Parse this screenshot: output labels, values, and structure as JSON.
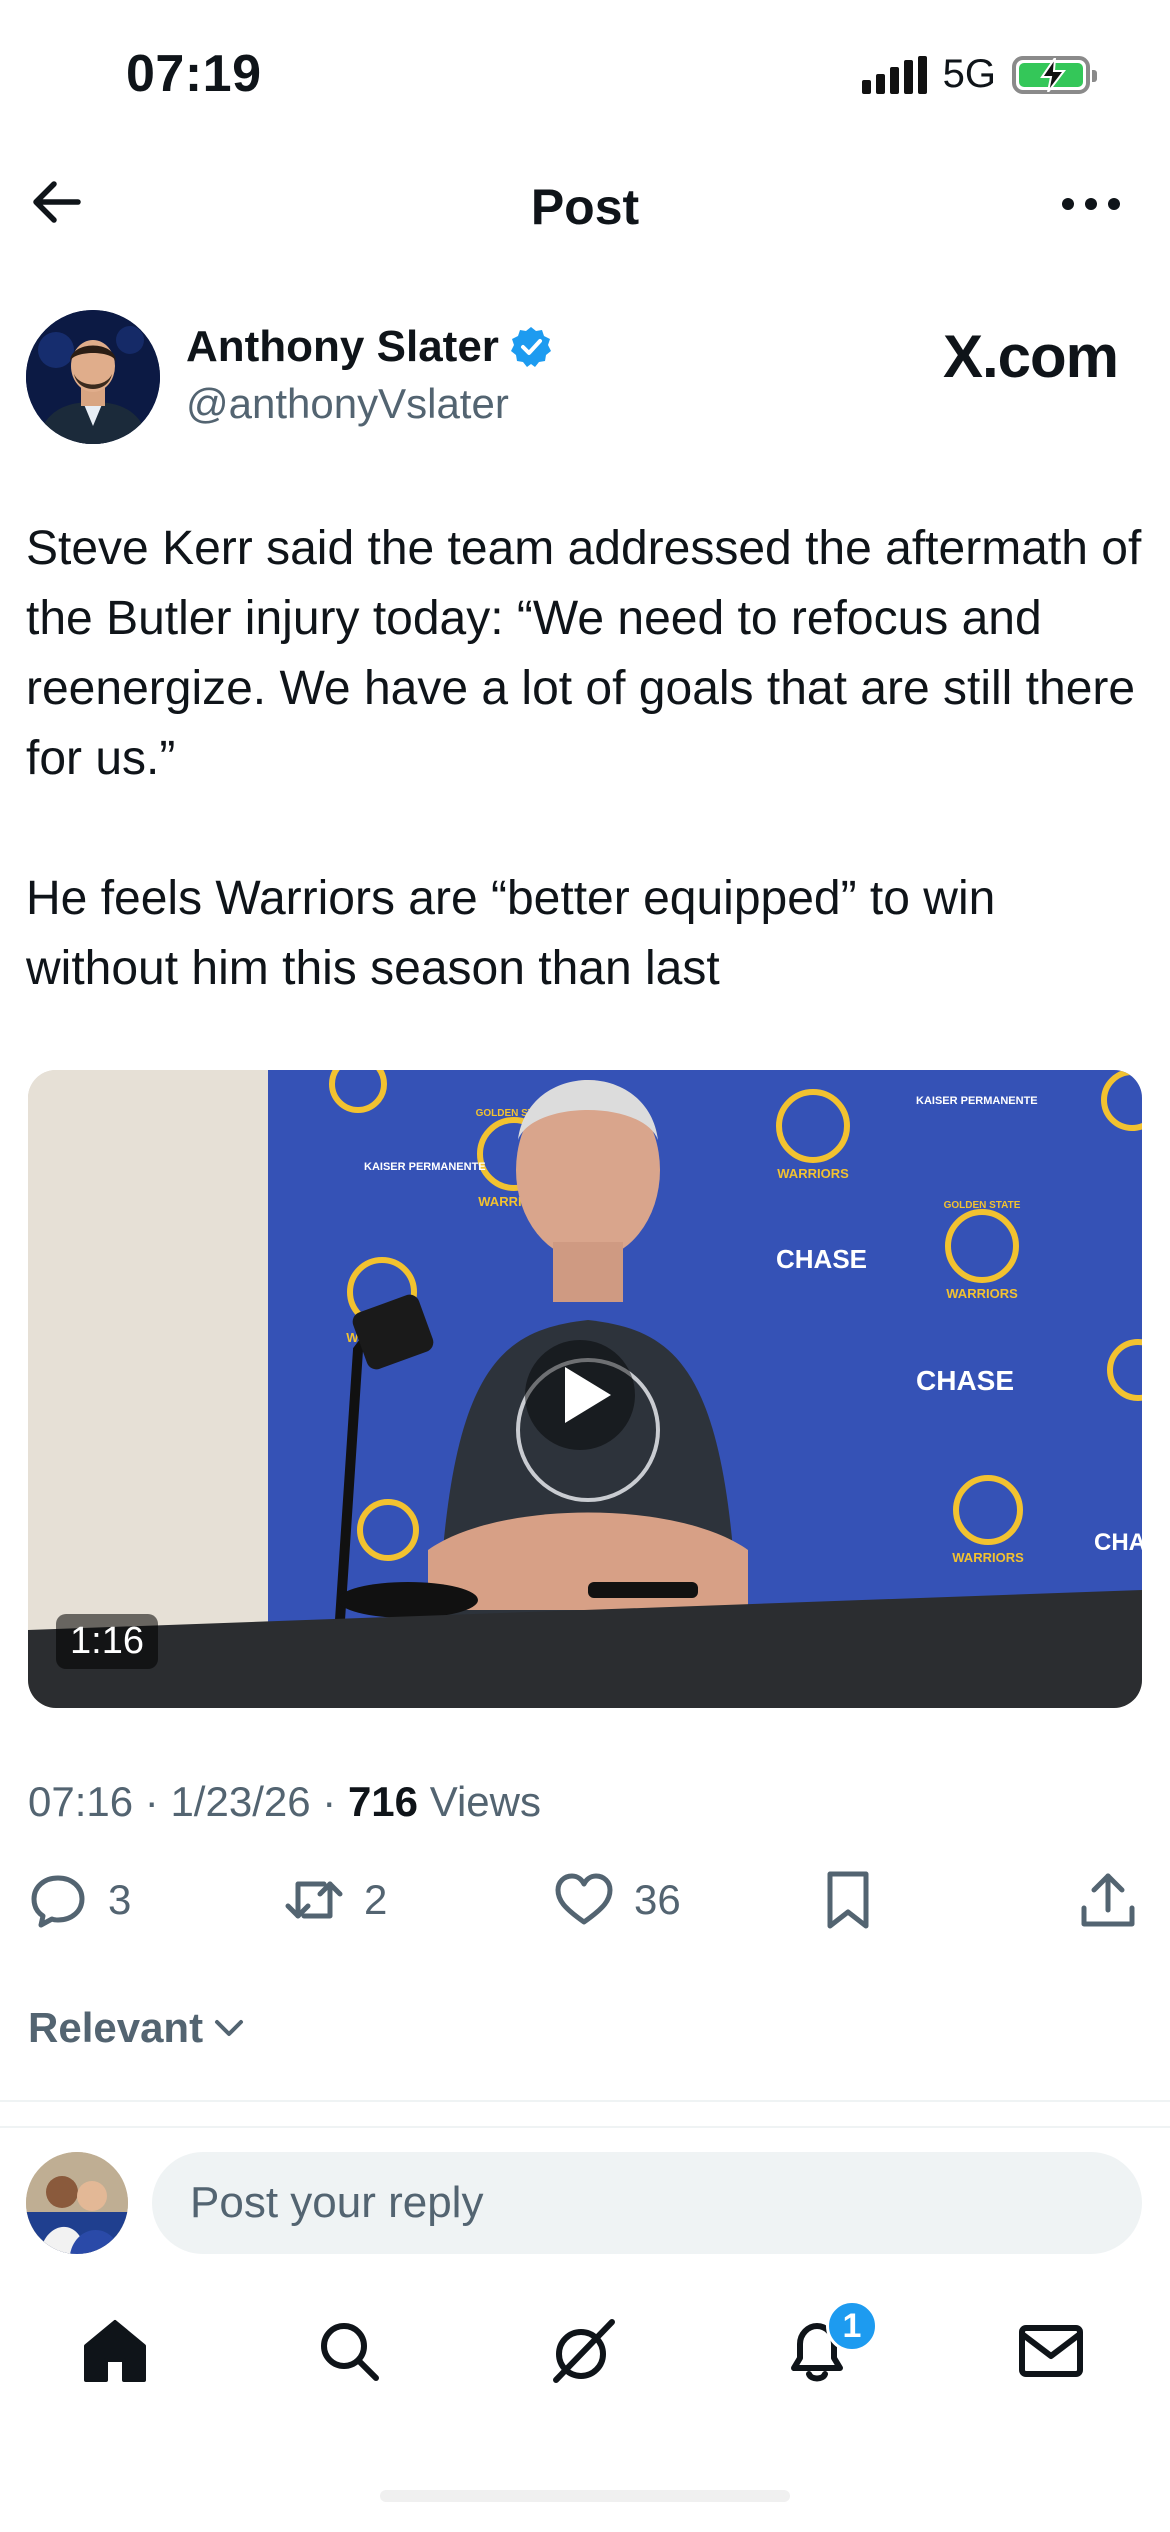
{
  "status_bar": {
    "time": "07:19",
    "network": "5G"
  },
  "header": {
    "title": "Post"
  },
  "author": {
    "name": "Anthony Slater",
    "handle": "@anthonyVslater",
    "source_label": "X.com"
  },
  "tweet": {
    "paragraphs": [
      "Steve Kerr said the team addressed the aftermath of the Butler injury today: “We need to refocus and reenergize. We have a lot of goals that are still there for us.”",
      "He feels Warriors are “better equipped” to win without him this season than last"
    ]
  },
  "media": {
    "duration": "1:16",
    "backdrop_labels": {
      "chase": "CHASE",
      "kaiser": "KAISER PERMANENTE",
      "warriors": "WARRIORS",
      "golden_state": "GOLDEN STATE"
    }
  },
  "meta": {
    "time": "07:16",
    "date": "1/23/26",
    "views_count": "716",
    "views_label": "Views",
    "separator": "·"
  },
  "actions": {
    "replies": "3",
    "reposts": "2",
    "likes": "36"
  },
  "sort": {
    "label": "Relevant"
  },
  "reply": {
    "placeholder": "Post your reply"
  },
  "tab_bar": {
    "notifications_badge": "1"
  },
  "colors": {
    "accent": "#1d9bf0",
    "secondary_text": "#536471",
    "backdrop_blue": "#3552b6",
    "battery_green": "#34c759"
  },
  "icons": [
    "back-arrow-icon",
    "more-icon",
    "verified-icon",
    "play-icon",
    "reply-icon",
    "repost-icon",
    "like-icon",
    "bookmark-icon",
    "share-icon",
    "chevron-down-icon",
    "home-icon",
    "search-icon",
    "grok-icon",
    "bell-icon",
    "mail-icon"
  ]
}
